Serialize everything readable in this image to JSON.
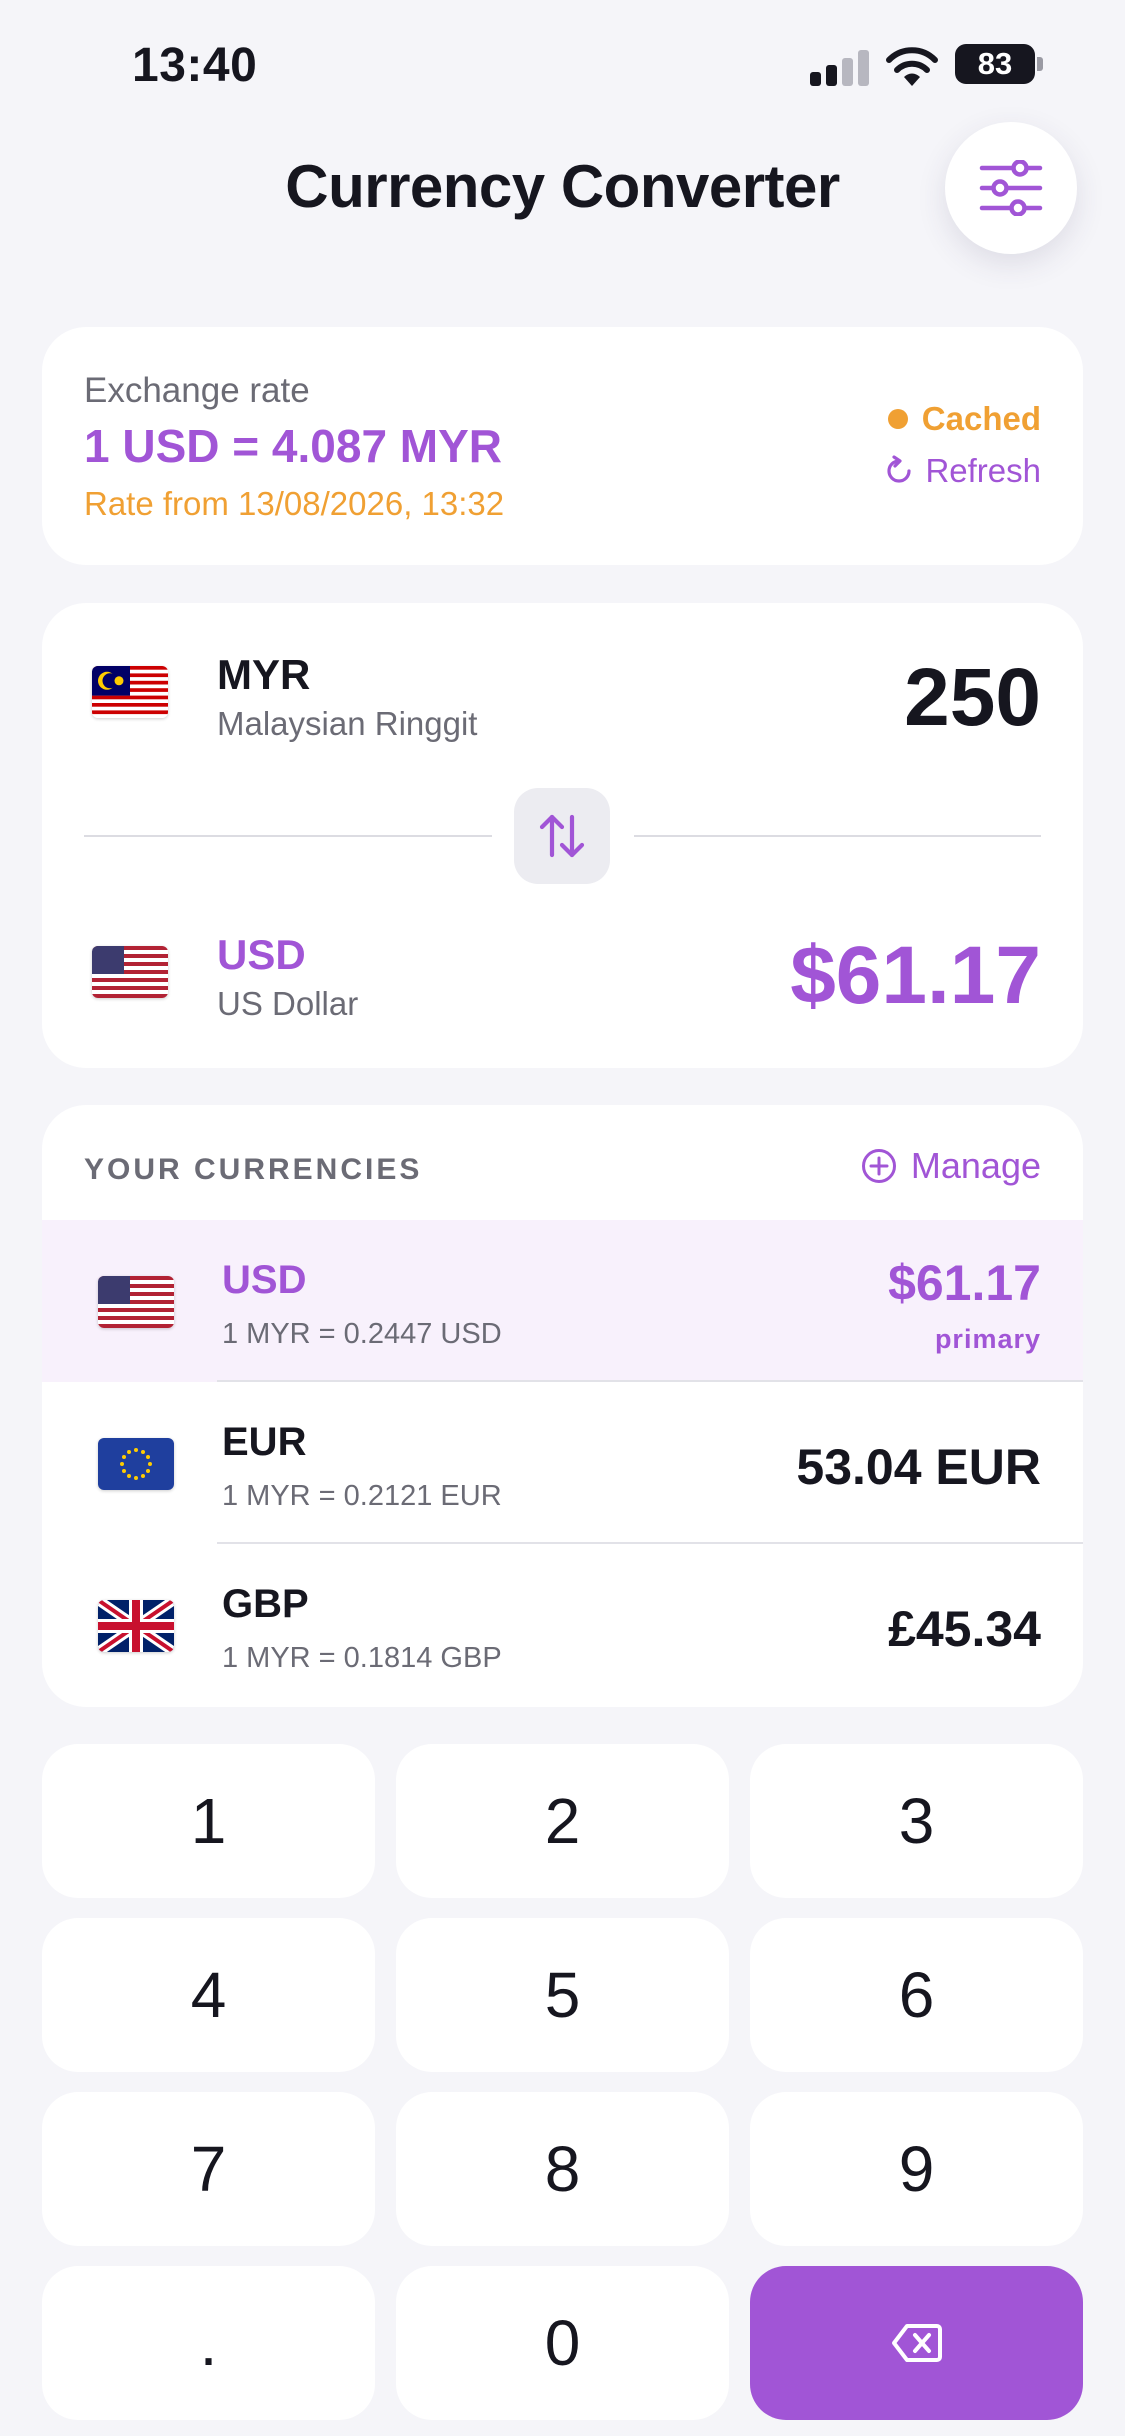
{
  "status_bar": {
    "time": "13:40",
    "battery": "83"
  },
  "header": {
    "title": "Currency Converter",
    "settings_icon": "sliders-icon"
  },
  "rate_card": {
    "label": "Exchange rate",
    "rate": "1 USD = 4.087 MYR",
    "updated": "Rate from 13/08/2026, 13:32",
    "cached_label": "Cached",
    "refresh_label": "Refresh"
  },
  "converter": {
    "from": {
      "code": "MYR",
      "name": "Malaysian Ringgit",
      "amount": "250",
      "flag": "malaysia-flag"
    },
    "to": {
      "code": "USD",
      "name": "US Dollar",
      "amount": "$61.17",
      "flag": "us-flag"
    },
    "swap_icon": "swap-vertical-icon"
  },
  "currencies": {
    "title": "YOUR CURRENCIES",
    "manage_label": "Manage",
    "items": [
      {
        "code": "USD",
        "rate": "1 MYR = 0.2447 USD",
        "value": "$61.17",
        "tag": "primary",
        "flag": "us-flag"
      },
      {
        "code": "EUR",
        "rate": "1 MYR = 0.2121 EUR",
        "value": "53.04 EUR",
        "flag": "eu-flag"
      },
      {
        "code": "GBP",
        "rate": "1 MYR = 0.1814 GBP",
        "value": "£45.34",
        "flag": "uk-flag"
      }
    ]
  },
  "keypad": {
    "keys": [
      "1",
      "2",
      "3",
      "4",
      "5",
      "6",
      "7",
      "8",
      "9",
      ".",
      "0"
    ],
    "backspace_icon": "backspace-icon"
  },
  "colors": {
    "accent": "#a155d6",
    "warning": "#f0a033",
    "background": "#f5f5f9",
    "text": "#16161f",
    "muted": "#6b6b75"
  }
}
